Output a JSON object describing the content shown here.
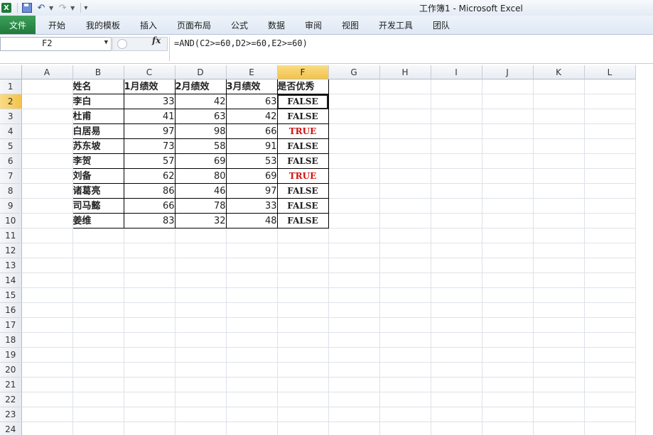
{
  "window": {
    "title": "工作簿1 - Microsoft Excel"
  },
  "ribbon": {
    "file_tab": "文件",
    "tabs": [
      "开始",
      "我的模板",
      "插入",
      "页面布局",
      "公式",
      "数据",
      "审阅",
      "视图",
      "开发工具",
      "团队"
    ]
  },
  "formula_bar": {
    "name_box": "F2",
    "fx_label": "fx",
    "formula": "=AND(C2>=60,D2>=60,E2>=60)"
  },
  "sheet": {
    "columns": [
      "A",
      "B",
      "C",
      "D",
      "E",
      "F",
      "G",
      "H",
      "I",
      "J",
      "K",
      "L"
    ],
    "rows": [
      "1",
      "2",
      "3",
      "4",
      "5",
      "6",
      "7",
      "8",
      "9",
      "10",
      "11",
      "12",
      "13",
      "14",
      "15",
      "16",
      "17",
      "18",
      "19",
      "20",
      "21",
      "22",
      "23",
      "24"
    ],
    "active_cell": "F2",
    "headers": [
      "姓名",
      "1月绩效",
      "2月绩效",
      "3月绩效",
      "是否优秀"
    ],
    "records": [
      [
        "李白",
        "33",
        "42",
        "63",
        "FALSE"
      ],
      [
        "杜甫",
        "41",
        "63",
        "42",
        "FALSE"
      ],
      [
        "白居易",
        "97",
        "98",
        "66",
        "TRUE"
      ],
      [
        "苏东坡",
        "73",
        "58",
        "91",
        "FALSE"
      ],
      [
        "李贺",
        "57",
        "69",
        "53",
        "FALSE"
      ],
      [
        "刘备",
        "62",
        "80",
        "69",
        "TRUE"
      ],
      [
        "诸葛亮",
        "86",
        "46",
        "97",
        "FALSE"
      ],
      [
        "司马懿",
        "66",
        "78",
        "33",
        "FALSE"
      ],
      [
        "姜维",
        "83",
        "32",
        "48",
        "FALSE"
      ]
    ]
  },
  "colors": {
    "true_value": "#d01010",
    "file_tab": "#1f7a3a",
    "selected_header": "#f3c34a"
  }
}
